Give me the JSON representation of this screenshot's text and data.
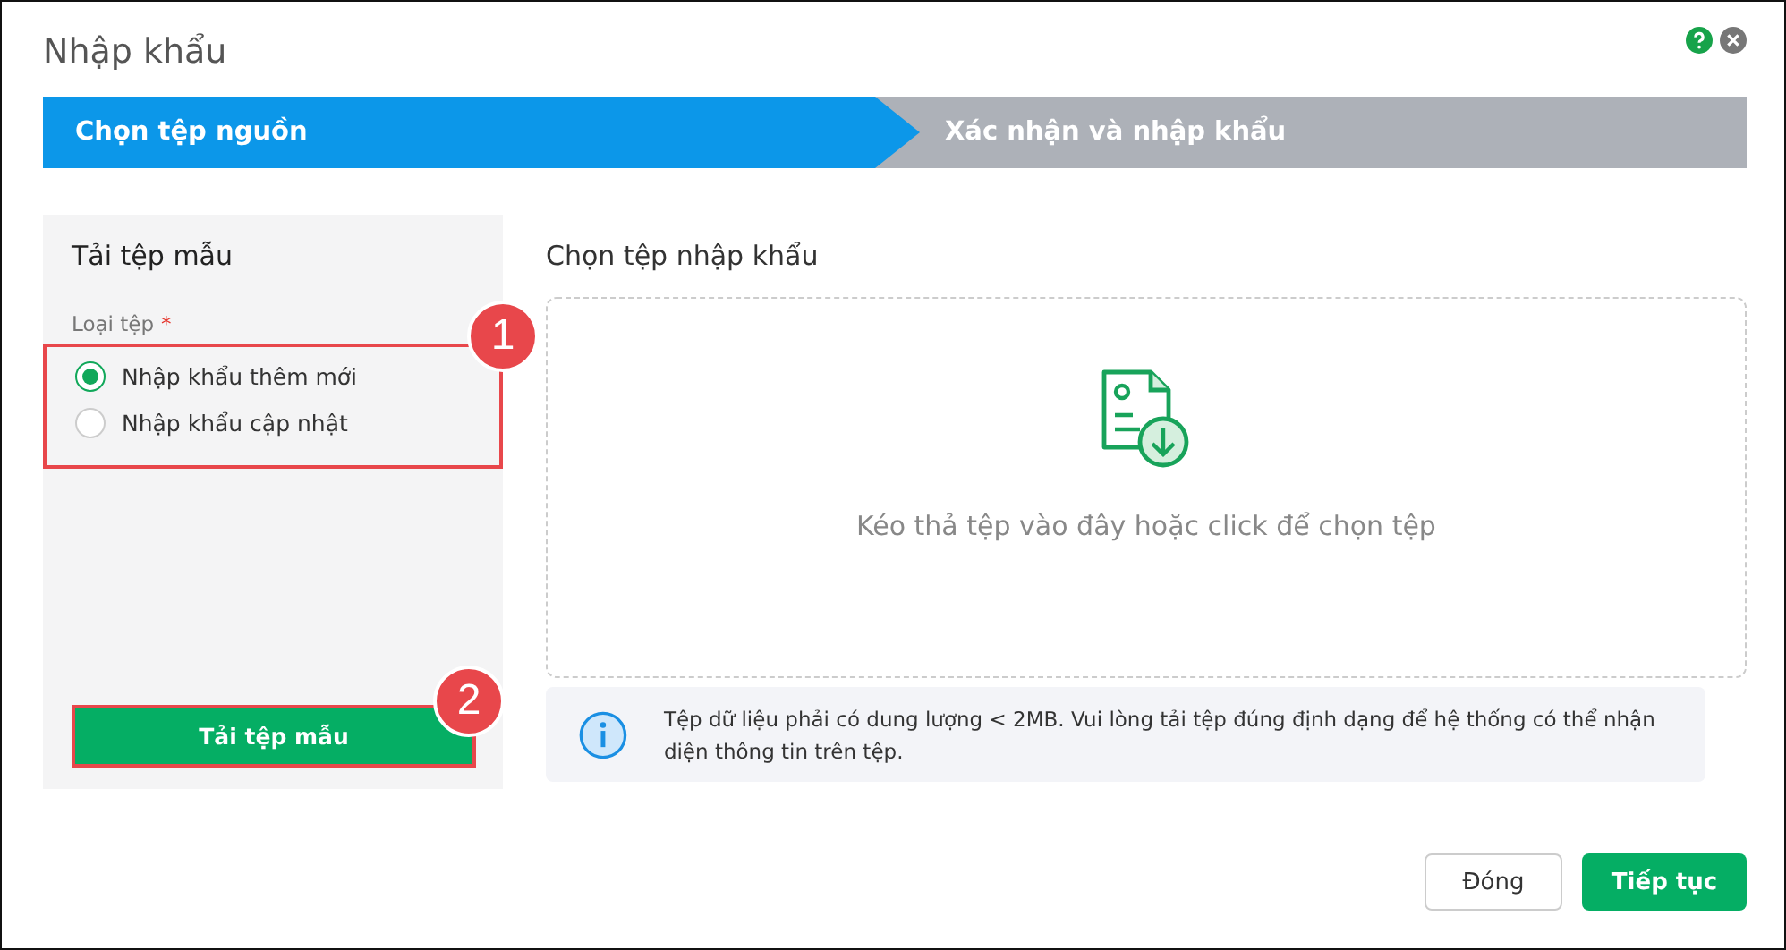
{
  "window": {
    "title": "Nhập khẩu"
  },
  "steps": [
    {
      "label": "Chọn tệp nguồn",
      "selected": true
    },
    {
      "label": "Xác nhận và nhập khẩu",
      "selected": false
    }
  ],
  "template_panel": {
    "title": "Tải tệp mẫu",
    "field_label": "Loại tệp",
    "required_mark": "*",
    "options": [
      {
        "label": "Nhập khẩu thêm mới",
        "selected": true
      },
      {
        "label": "Nhập khẩu cập nhật",
        "selected": false
      }
    ],
    "option_callout": "1",
    "download_button": "Tải tệp mẫu",
    "download_callout": "2"
  },
  "import_panel": {
    "title": "Chọn tệp nhập khẩu",
    "dropzone_text": "Kéo thả tệp vào đây hoặc click để chọn tệp",
    "info": "Tệp dữ liệu phải có dung lượng < 2MB. Vui lòng tải tệp đúng định dạng để hệ thống có thể nhận diện thông tin trên tệp."
  },
  "buttons": [
    {
      "label": "Đóng",
      "kind": "secondary"
    },
    {
      "label": "Tiếp tục",
      "kind": "primary"
    }
  ]
}
